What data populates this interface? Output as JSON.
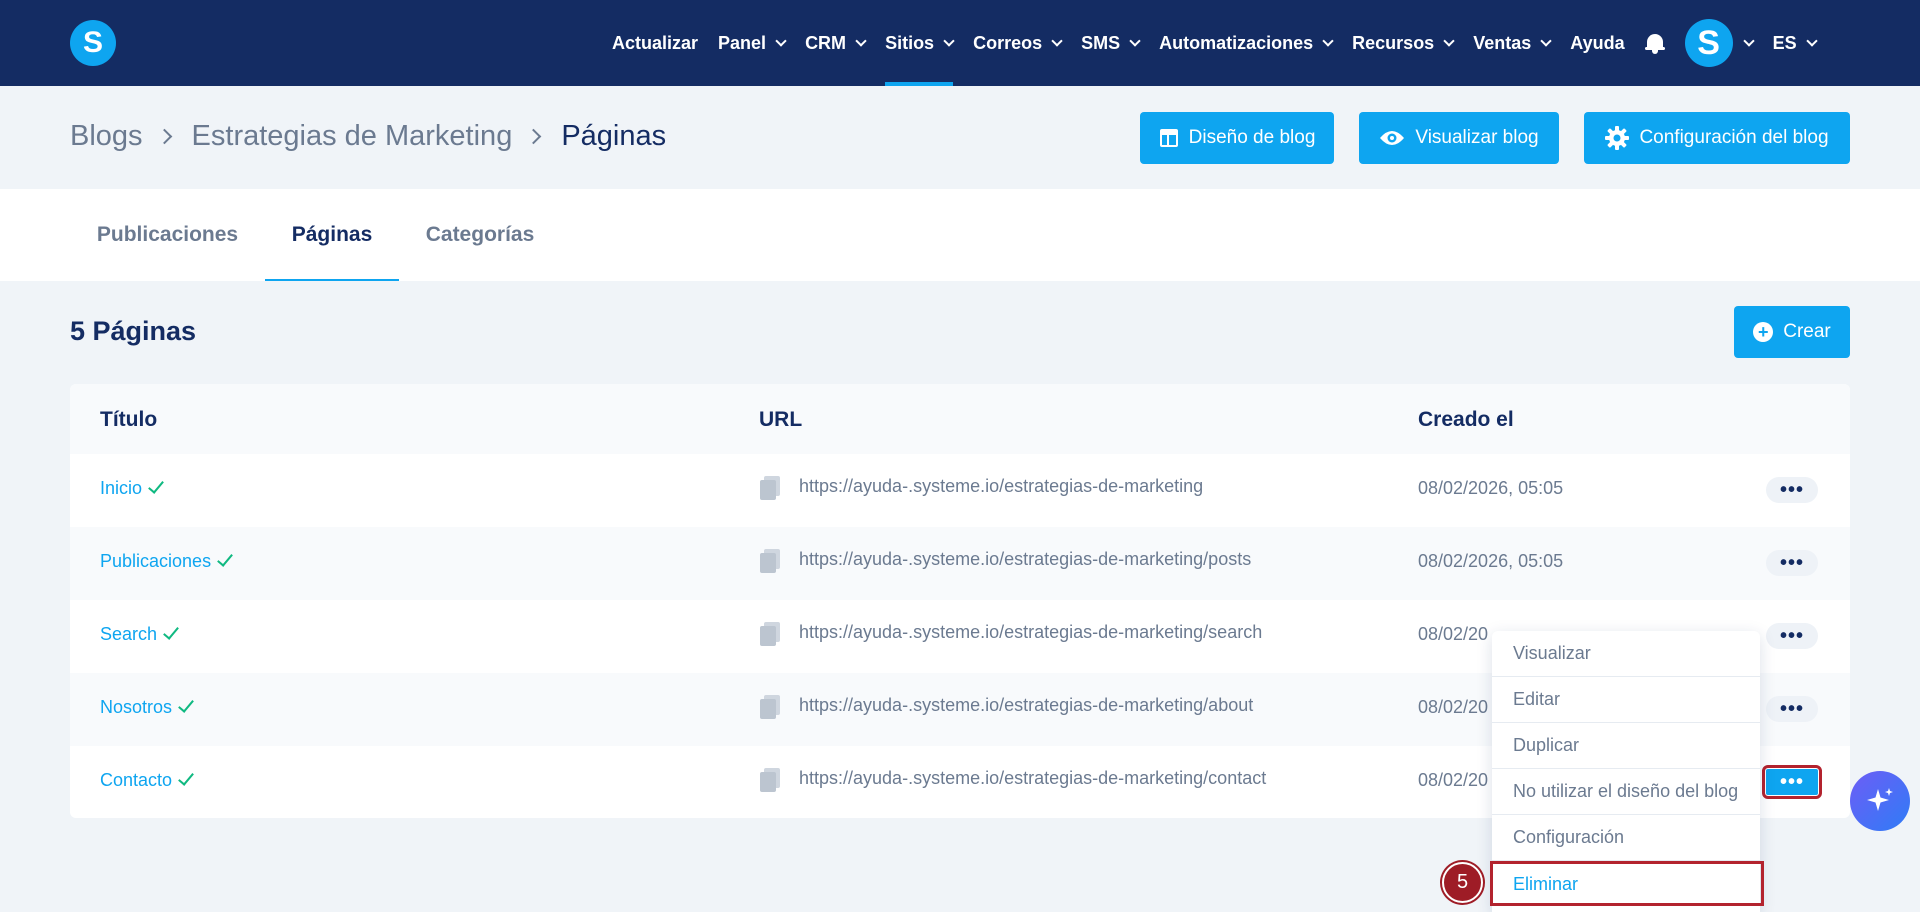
{
  "nav": {
    "items": [
      {
        "label": "Actualizar",
        "dropdown": false,
        "active": false
      },
      {
        "label": "Panel",
        "dropdown": true,
        "active": false
      },
      {
        "label": "CRM",
        "dropdown": true,
        "active": false
      },
      {
        "label": "Sitios",
        "dropdown": true,
        "active": true
      },
      {
        "label": "Correos",
        "dropdown": true,
        "active": false
      },
      {
        "label": "SMS",
        "dropdown": true,
        "active": false
      },
      {
        "label": "Automatizaciones",
        "dropdown": true,
        "active": false
      },
      {
        "label": "Recursos",
        "dropdown": true,
        "active": false
      },
      {
        "label": "Ventas",
        "dropdown": true,
        "active": false
      },
      {
        "label": "Ayuda",
        "dropdown": false,
        "active": false
      }
    ],
    "logo_letter": "S",
    "avatar_letter": "S",
    "language": "ES"
  },
  "breadcrumb": {
    "items": [
      "Blogs",
      "Estrategias de Marketing"
    ],
    "current": "Páginas"
  },
  "header_buttons": {
    "design": "Diseño de blog",
    "view": "Visualizar blog",
    "settings": "Configuración del blog"
  },
  "tabs": [
    {
      "label": "Publicaciones",
      "active": false
    },
    {
      "label": "Páginas",
      "active": true
    },
    {
      "label": "Categorías",
      "active": false
    }
  ],
  "page": {
    "count_title": "5 Páginas",
    "create_label": "Crear"
  },
  "table": {
    "headers": {
      "title": "Título",
      "url": "URL",
      "created": "Creado el"
    },
    "rows": [
      {
        "title": "Inicio",
        "url": "https://ayuda-.systeme.io/estrategias-de-marketing",
        "date": "08/02/2026, 05:05"
      },
      {
        "title": "Publicaciones",
        "url": "https://ayuda-.systeme.io/estrategias-de-marketing/posts",
        "date": "08/02/2026, 05:05"
      },
      {
        "title": "Search",
        "url": "https://ayuda-.systeme.io/estrategias-de-marketing/search",
        "date": "08/02/20"
      },
      {
        "title": "Nosotros",
        "url": "https://ayuda-.systeme.io/estrategias-de-marketing/about",
        "date": "08/02/20"
      },
      {
        "title": "Contacto",
        "url": "https://ayuda-.systeme.io/estrategias-de-marketing/contact",
        "date": "08/02/20"
      }
    ],
    "more_symbol": "•••"
  },
  "menu": {
    "items": [
      "Visualizar",
      "Editar",
      "Duplicar",
      "No utilizar el diseño del blog",
      "Configuración",
      "Eliminar"
    ]
  },
  "step_number": "5",
  "colors": {
    "nav_bg": "#142c63",
    "accent": "#0ea5f0",
    "highlight": "#b3232e",
    "success": "#10b981"
  }
}
